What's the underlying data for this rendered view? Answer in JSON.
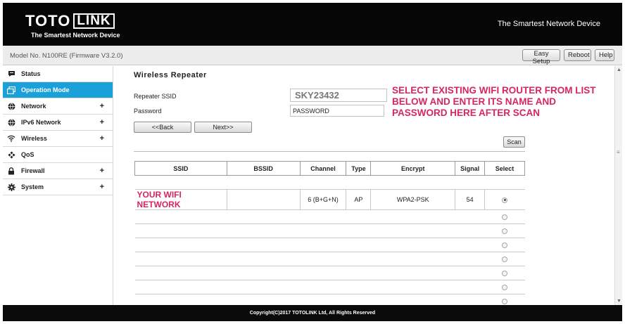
{
  "header": {
    "logo_toto": "TOTO",
    "logo_link": "LINK",
    "logo_tagline": "The Smartest Network Device",
    "slogan": "The Smartest Network Device"
  },
  "model_bar": {
    "model_text": "Model No. N100RE (Firmware V3.2.0)",
    "easy_setup_label": "Easy Setup",
    "reboot_label": "Reboot",
    "help_label": "Help"
  },
  "sidebar": {
    "items": [
      {
        "label": "Status",
        "icon": "status-icon",
        "expandable": false
      },
      {
        "label": "Operation Mode",
        "icon": "operation-mode-icon",
        "expandable": false
      },
      {
        "label": "Network",
        "icon": "globe-icon",
        "expandable": true
      },
      {
        "label": "IPv6 Network",
        "icon": "globe-icon",
        "expandable": true
      },
      {
        "label": "Wireless",
        "icon": "wifi-icon",
        "expandable": true
      },
      {
        "label": "QoS",
        "icon": "qos-icon",
        "expandable": false
      },
      {
        "label": "Firewall",
        "icon": "lock-icon",
        "expandable": true
      },
      {
        "label": "System",
        "icon": "gear-icon",
        "expandable": true
      }
    ],
    "expand_symbol": "+",
    "active_color": "#1ba1d9"
  },
  "main": {
    "title": "Wireless Repeater",
    "ssid_label": "Repeater SSID",
    "ssid_value": "SKY23432",
    "password_label": "Password",
    "password_value": "PASSWORD",
    "back_label": "<<Back",
    "next_label": "Next>>",
    "scan_label": "Scan"
  },
  "annotation": {
    "text": "SELECT EXISTING WIFI ROUTER FROM LIST BELOW AND ENTER ITS NAME AND PASSWORD HERE AFTER SCAN",
    "color": "#d6265f"
  },
  "table": {
    "headers": [
      "SSID",
      "BSSID",
      "Channel",
      "Type",
      "Encrypt",
      "Signal",
      "Select"
    ],
    "rows": [
      {
        "ssid": "YOUR WIFI NETWORK",
        "bssid": "",
        "channel": "6 (B+G+N)",
        "type": "AP",
        "encrypt": "WPA2-PSK",
        "signal": "54",
        "selected": true
      },
      {
        "ssid": "",
        "bssid": "",
        "channel": "",
        "type": "",
        "encrypt": "",
        "signal": "",
        "selected": false
      },
      {
        "ssid": "",
        "bssid": "",
        "channel": "",
        "type": "",
        "encrypt": "",
        "signal": "",
        "selected": false
      },
      {
        "ssid": "",
        "bssid": "",
        "channel": "",
        "type": "",
        "encrypt": "",
        "signal": "",
        "selected": false
      },
      {
        "ssid": "",
        "bssid": "",
        "channel": "",
        "type": "",
        "encrypt": "",
        "signal": "",
        "selected": false
      },
      {
        "ssid": "",
        "bssid": "",
        "channel": "",
        "type": "",
        "encrypt": "",
        "signal": "",
        "selected": false
      },
      {
        "ssid": "",
        "bssid": "",
        "channel": "",
        "type": "",
        "encrypt": "",
        "signal": "",
        "selected": false
      },
      {
        "ssid": "",
        "bssid": "",
        "channel": "",
        "type": "",
        "encrypt": "",
        "signal": "",
        "selected": false
      }
    ]
  },
  "footer": {
    "copyright": "Copyright(C)2017 TOTOLINK Ltd, All Rights Reserved"
  }
}
